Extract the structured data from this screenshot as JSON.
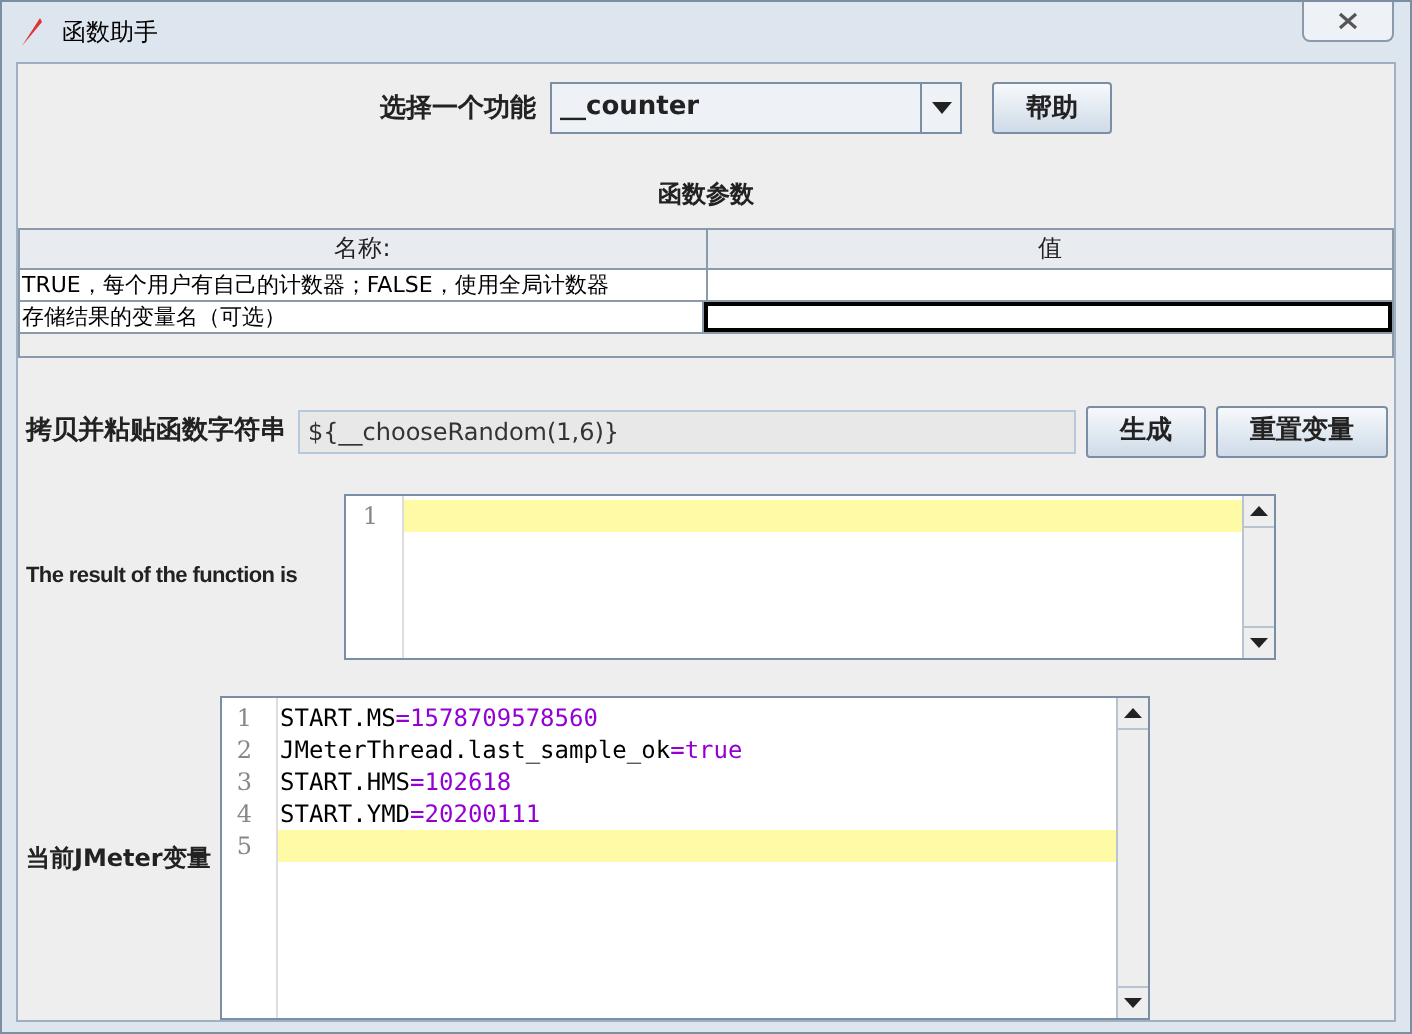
{
  "window": {
    "title": "函数助手"
  },
  "function_select": {
    "label": "选择一个功能",
    "value": "__counter",
    "help_button": "帮助"
  },
  "parameters": {
    "title": "函数参数",
    "columns": [
      "名称:",
      "值"
    ],
    "rows": [
      {
        "name": "TRUE，每个用户有自己的计数器；FALSE，使用全局计数器",
        "focused": false
      },
      {
        "name": "存储结果的变量名（可选）",
        "focused": true
      }
    ]
  },
  "function_string": {
    "label": "拷贝并粘贴函数字符串",
    "value": "${__chooseRandom(1,6)}",
    "buttons": [
      "生成",
      "重置变量"
    ]
  },
  "result": {
    "label": "The result of the function is",
    "lines": [
      {
        "number": "1",
        "current": true
      }
    ]
  },
  "variables": {
    "label": "当前JMeter变量",
    "lines": [
      {
        "number": "1",
        "key": "START.MS",
        "sep": "=",
        "value": "1578709578560",
        "current": false
      },
      {
        "number": "2",
        "key": "JMeterThread.last_sample_ok",
        "sep": "=",
        "value": "true",
        "current": false
      },
      {
        "number": "3",
        "key": "START.HMS",
        "sep": "=",
        "value": "102618",
        "current": false
      },
      {
        "number": "4",
        "key": "START.YMD",
        "sep": "=",
        "value": "20200111",
        "current": false
      },
      {
        "number": "5",
        "current": true
      }
    ]
  }
}
